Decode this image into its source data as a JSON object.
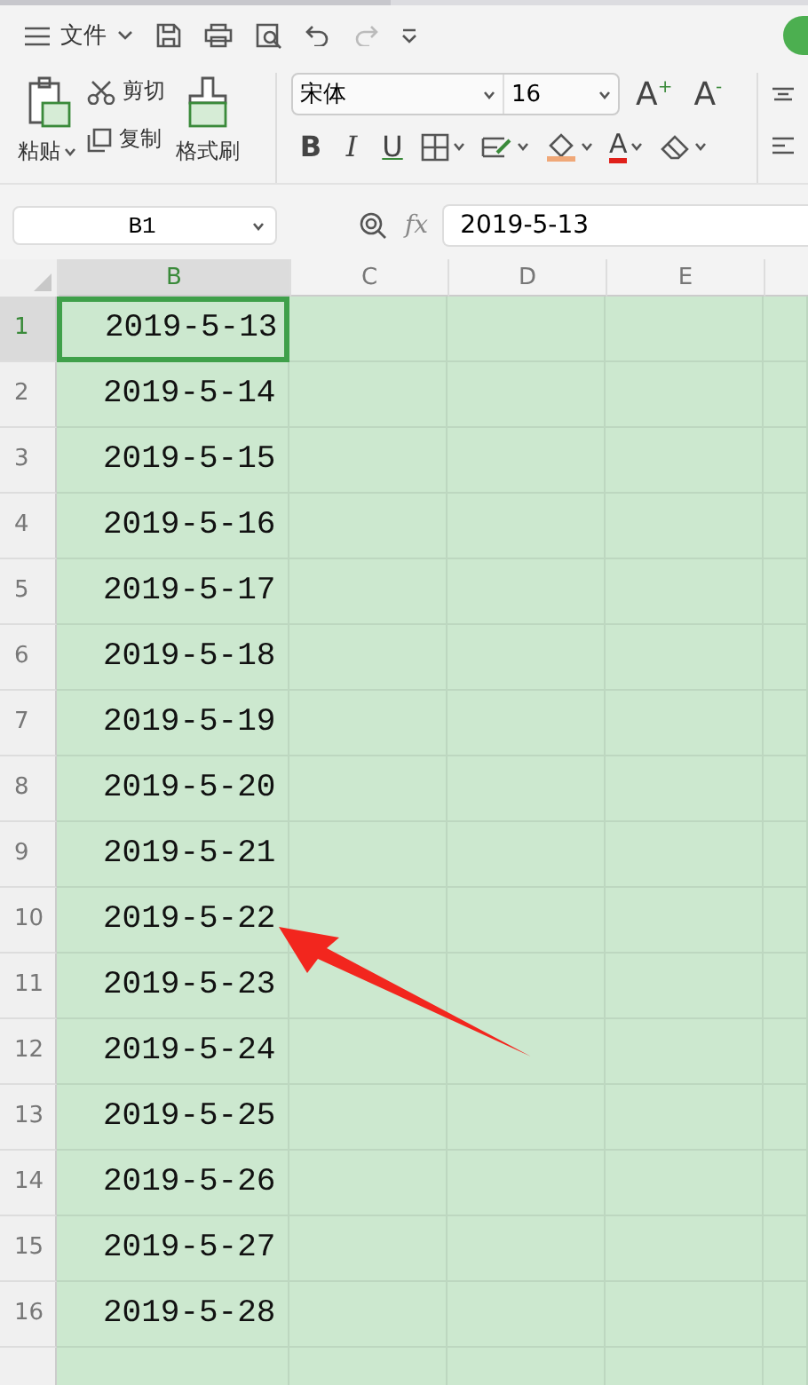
{
  "menu": {
    "label": "文件"
  },
  "ribbon": {
    "paste": "粘贴",
    "cut": "剪切",
    "copy": "复制",
    "format_painter": "格式刷",
    "font_name": "宋体",
    "font_size": "16",
    "bold": "B",
    "italic": "I",
    "underline": "U",
    "grow_font": "A$^{+}$",
    "shrink_font": "A$^{-}$",
    "font_color": "A"
  },
  "formula_bar": {
    "name_box": "B1",
    "fx": "fx",
    "value": "2019-5-13"
  },
  "columns": [
    {
      "label": "B",
      "selected": true
    },
    {
      "label": "C",
      "selected": false
    },
    {
      "label": "D",
      "selected": false
    },
    {
      "label": "E",
      "selected": false
    }
  ],
  "rows": [
    {
      "number": "1",
      "value": "2019-5-13",
      "selected": true
    },
    {
      "number": "2",
      "value": "2019-5-14",
      "selected": false
    },
    {
      "number": "3",
      "value": "2019-5-15",
      "selected": false
    },
    {
      "number": "4",
      "value": "2019-5-16",
      "selected": false
    },
    {
      "number": "5",
      "value": "2019-5-17",
      "selected": false
    },
    {
      "number": "6",
      "value": "2019-5-18",
      "selected": false
    },
    {
      "number": "7",
      "value": "2019-5-19",
      "selected": false
    },
    {
      "number": "8",
      "value": "2019-5-20",
      "selected": false
    },
    {
      "number": "9",
      "value": "2019-5-21",
      "selected": false
    },
    {
      "number": "10",
      "value": "2019-5-22",
      "selected": false
    },
    {
      "number": "11",
      "value": "2019-5-23",
      "selected": false
    },
    {
      "number": "12",
      "value": "2019-5-24",
      "selected": false
    },
    {
      "number": "13",
      "value": "2019-5-25",
      "selected": false
    },
    {
      "number": "14",
      "value": "2019-5-26",
      "selected": false
    },
    {
      "number": "15",
      "value": "2019-5-27",
      "selected": false
    },
    {
      "number": "16",
      "value": "2019-5-28",
      "selected": false
    }
  ]
}
